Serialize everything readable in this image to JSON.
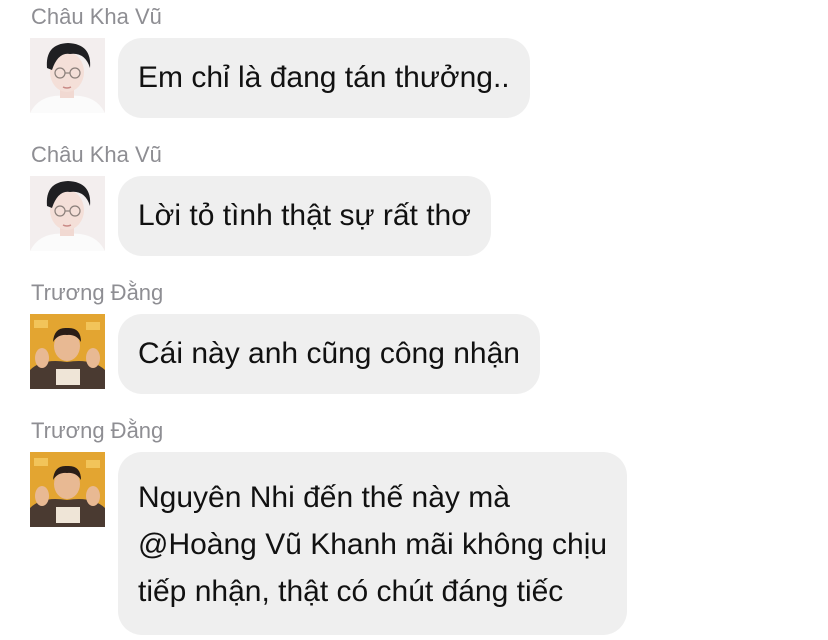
{
  "messages": [
    {
      "sender": "Châu Kha Vũ",
      "text": "Em chỉ là đang tán thưởng..",
      "avatar": "avatar-chau-kha-vu"
    },
    {
      "sender": "Châu Kha Vũ",
      "text": "Lời tỏ tình thật sự rất thơ",
      "avatar": "avatar-chau-kha-vu"
    },
    {
      "sender": "Trương Đằng",
      "text": "Cái này anh cũng công nhận",
      "avatar": "avatar-truong-dang"
    },
    {
      "sender": "Trương Đằng",
      "lines": [
        "Nguyên Nhi đến thế này mà",
        "@Hoàng Vũ Khanh mãi không chịu",
        "tiếp nhận, thật có chút đáng tiếc"
      ],
      "avatar": "avatar-truong-dang"
    }
  ],
  "colors": {
    "bubble": "#efefef",
    "sender_name": "#8e8e93",
    "message_text": "#111111",
    "background": "#ffffff"
  }
}
